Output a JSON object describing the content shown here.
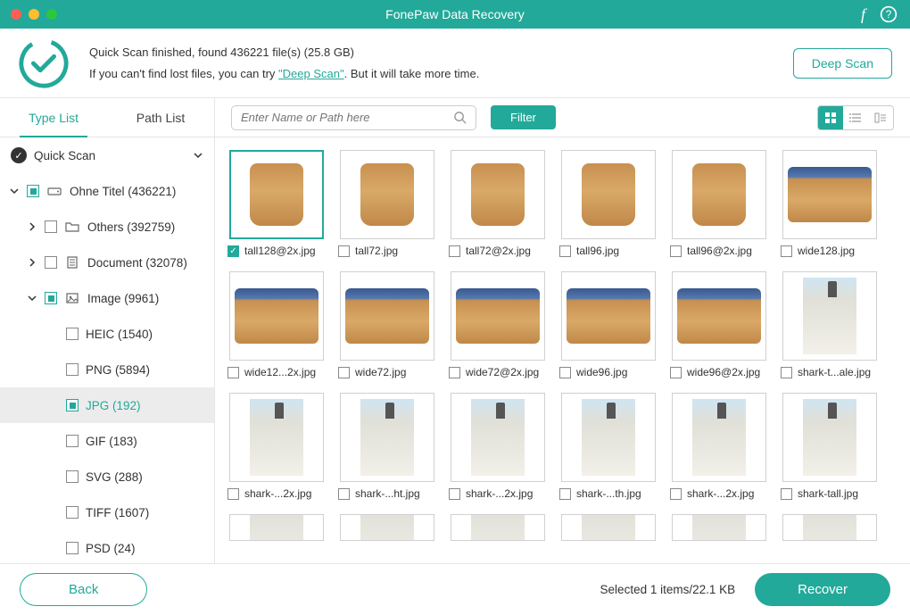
{
  "app_title": "FonePaw Data Recovery",
  "status": {
    "line1": "Quick Scan finished, found 436221 file(s) (25.8 GB)",
    "line2_a": "If you can't find lost files, you can try ",
    "line2_link": "\"Deep Scan\"",
    "line2_b": ". But it will take more time.",
    "deep_scan_btn": "Deep Scan"
  },
  "sidebar": {
    "tab1": "Type List",
    "tab2": "Path List",
    "quick_scan": "Quick Scan",
    "root": "Ohne Titel (436221)",
    "others": "Others (392759)",
    "document": "Document (32078)",
    "image": "Image (9961)",
    "heic": "HEIC (1540)",
    "png": "PNG (5894)",
    "jpg": "JPG (192)",
    "gif": "GIF (183)",
    "svg": "SVG (288)",
    "tiff": "TIFF (1607)",
    "psd": "PSD (24)"
  },
  "toolbar": {
    "search_placeholder": "Enter Name or Path here",
    "filter": "Filter"
  },
  "thumbs": [
    {
      "name": "tall128@2x.jpg",
      "kind": "dog",
      "sel": true
    },
    {
      "name": "tall72.jpg",
      "kind": "dog"
    },
    {
      "name": "tall72@2x.jpg",
      "kind": "dog"
    },
    {
      "name": "tall96.jpg",
      "kind": "dog"
    },
    {
      "name": "tall96@2x.jpg",
      "kind": "dog"
    },
    {
      "name": "wide128.jpg",
      "kind": "dogw"
    },
    {
      "name": "wide12...2x.jpg",
      "kind": "dogw"
    },
    {
      "name": "wide72.jpg",
      "kind": "dogw"
    },
    {
      "name": "wide72@2x.jpg",
      "kind": "dogw"
    },
    {
      "name": "wide96.jpg",
      "kind": "dogw"
    },
    {
      "name": "wide96@2x.jpg",
      "kind": "dogw"
    },
    {
      "name": "shark-t...ale.jpg",
      "kind": "lh"
    },
    {
      "name": "shark-...2x.jpg",
      "kind": "lh"
    },
    {
      "name": "shark-...ht.jpg",
      "kind": "lh"
    },
    {
      "name": "shark-...2x.jpg",
      "kind": "lh"
    },
    {
      "name": "shark-...th.jpg",
      "kind": "lh"
    },
    {
      "name": "shark-...2x.jpg",
      "kind": "lh"
    },
    {
      "name": "shark-tall.jpg",
      "kind": "lh"
    }
  ],
  "footer": {
    "back": "Back",
    "selected": "Selected 1 items/22.1 KB",
    "recover": "Recover"
  }
}
